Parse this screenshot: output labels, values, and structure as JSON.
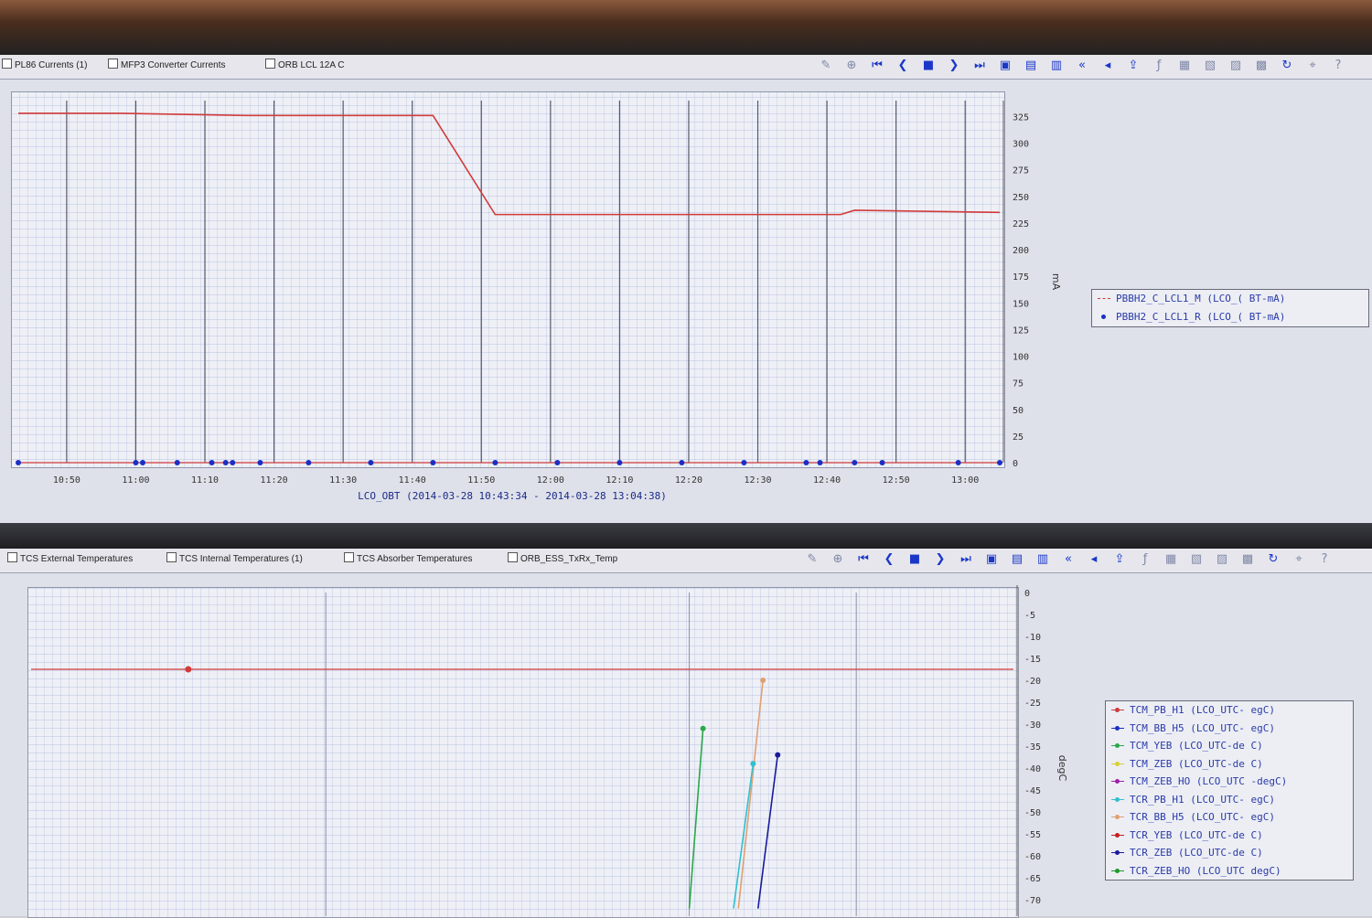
{
  "top_window": {
    "tabs": [
      {
        "label": "PL86 Currents (1)"
      },
      {
        "label": "MFP3 Converter Currents"
      },
      {
        "label": "ORB LCL 12A C"
      }
    ],
    "toolbar_icons": [
      "edit-icon",
      "zoom-icon",
      "first-icon",
      "prev-icon",
      "stop-icon",
      "next-icon",
      "last-icon",
      "chart-mode-icon",
      "chart-mode-icon-2",
      "bars-icon",
      "rewind-icon",
      "fast-rewind-icon",
      "export-icon",
      "fx-icon",
      "grid-icon",
      "table-icon",
      "layout-icon",
      "stats-icon",
      "refresh-icon",
      "pin-icon",
      "help-icon"
    ],
    "legend": [
      {
        "label": "PBBH2_C_LCL1_M (LCO_( BT-mA)",
        "color": "#d23a3a",
        "style": "dash"
      },
      {
        "label": "PBBH2_C_LCL1_R (LCO_( BT-mA)",
        "color": "#1a2fc4",
        "style": "dot"
      }
    ]
  },
  "bottom_window": {
    "tabs": [
      {
        "label": "TCS External Temperatures"
      },
      {
        "label": "TCS Internal Temperatures (1)"
      },
      {
        "label": "TCS Absorber Temperatures"
      },
      {
        "label": "ORB_ESS_TxRx_Temp"
      }
    ],
    "legend": [
      {
        "label": "TCM_PB_H1 (LCO_UTC- egC)",
        "color": "#d23a3a"
      },
      {
        "label": "TCM_BB_H5 (LCO_UTC- egC)",
        "color": "#1a2fc4"
      },
      {
        "label": "TCM_YEB (LCO_UTC-de C)",
        "color": "#2aa84a"
      },
      {
        "label": "TCM_ZEB (LCO_UTC-de C)",
        "color": "#d8d030"
      },
      {
        "label": "TCM_ZEB_HO (LCO_UTC -degC)",
        "color": "#a020a8"
      },
      {
        "label": "TCR_PB_H1 (LCO_UTC- egC)",
        "color": "#30c0d0"
      },
      {
        "label": "TCR_BB_H5 (LCO_UTC- egC)",
        "color": "#e0a070"
      },
      {
        "label": "TCR_YEB (LCO_UTC-de C)",
        "color": "#c81e1e"
      },
      {
        "label": "TCR_ZEB (LCO_UTC-de C)",
        "color": "#1a1a9a"
      },
      {
        "label": "TCR_ZEB_HO (LCO_UTC degC)",
        "color": "#1e9a2a"
      }
    ]
  },
  "chart_data": [
    {
      "type": "line",
      "xlabel": "LCO_OBT (2014-03-28 10:43:34 - 2014-03-28 13:04:38)",
      "ylabel": "mA",
      "x_ticks": [
        "10:50",
        "11:00",
        "11:10",
        "11:20",
        "11:30",
        "11:40",
        "11:50",
        "12:00",
        "12:10",
        "12:20",
        "12:30",
        "12:40",
        "12:50",
        "13:00"
      ],
      "y_ticks": [
        "0",
        "25",
        "50",
        "75",
        "100",
        "125",
        "150",
        "175",
        "200",
        "225",
        "250",
        "275",
        "300",
        "325"
      ],
      "ylim": [
        0,
        340
      ],
      "xlim": [
        "10:43",
        "13:05"
      ],
      "series": [
        {
          "name": "PBBH2_C_LCL1_M (LCO_( BT-mA)",
          "color": "#d23a3a",
          "x": [
            "10:43",
            "10:58",
            "11:16",
            "11:43",
            "11:52",
            "12:35",
            "12:42",
            "12:44",
            "13:05"
          ],
          "y": [
            328,
            328,
            326,
            326,
            233,
            233,
            233,
            237,
            235
          ]
        },
        {
          "name": "PBBH2_C_LCL1_R (LCO_( BT-mA)",
          "color": "#1a2fc4",
          "x": [
            "10:43",
            "11:00",
            "11:01",
            "11:06",
            "11:11",
            "11:13",
            "11:14",
            "11:18",
            "11:25",
            "11:34",
            "11:43",
            "11:52",
            "12:01",
            "12:10",
            "12:19",
            "12:28",
            "12:37",
            "12:39",
            "12:44",
            "12:48",
            "12:59",
            "13:05"
          ],
          "y": [
            0,
            0,
            0,
            0,
            0,
            0,
            0,
            0,
            0,
            0,
            0,
            0,
            0,
            0,
            0,
            0,
            0,
            0,
            0,
            0,
            0,
            0
          ]
        }
      ]
    },
    {
      "type": "line",
      "ylabel": "degC",
      "y_ticks": [
        "0",
        "-5",
        "-10",
        "-15",
        "-20",
        "-25",
        "-30",
        "-35",
        "-40",
        "-45",
        "-50",
        "-55",
        "-60",
        "-65",
        "-70"
      ],
      "ylim": [
        -70,
        0
      ],
      "series": [
        {
          "name": "TCM_PB_H1 (LCO_UTC- egC)",
          "color": "#d23a3a",
          "x": [
            0,
            0.16,
            1
          ],
          "y": [
            -17.5,
            -17.5,
            -17.5
          ]
        },
        {
          "name": "TCM_YEB (LCO_UTC-de C)",
          "color": "#2aa84a",
          "x": [
            0.67,
            0.684
          ],
          "y": [
            -72,
            -31
          ]
        },
        {
          "name": "TCR_BB_H5 (LCO_UTC- egC)",
          "color": "#e0a070",
          "x": [
            0.72,
            0.745
          ],
          "y": [
            -72,
            -20
          ]
        },
        {
          "name": "TCR_PB_H1 (LCO_UTC- egC)",
          "color": "#30c0d0",
          "x": [
            0.715,
            0.735
          ],
          "y": [
            -72,
            -39
          ]
        },
        {
          "name": "TCR_ZEB (LCO_UTC-de C)",
          "color": "#1a1a9a",
          "x": [
            0.74,
            0.76
          ],
          "y": [
            -72,
            -37
          ]
        }
      ]
    }
  ]
}
